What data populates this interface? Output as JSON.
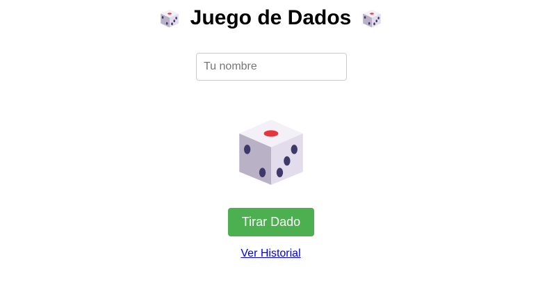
{
  "header": {
    "title": "Juego de Dados",
    "left_icon": "game-die-icon",
    "right_icon": "game-die-icon"
  },
  "name_input": {
    "placeholder": "Tu nombre",
    "value": ""
  },
  "dice": {
    "icon": "game-die-icon"
  },
  "roll_button": {
    "label": "Tirar Dado",
    "color": "#4caf50"
  },
  "history_link": {
    "label": "Ver Historial",
    "color": "#0000ee"
  }
}
